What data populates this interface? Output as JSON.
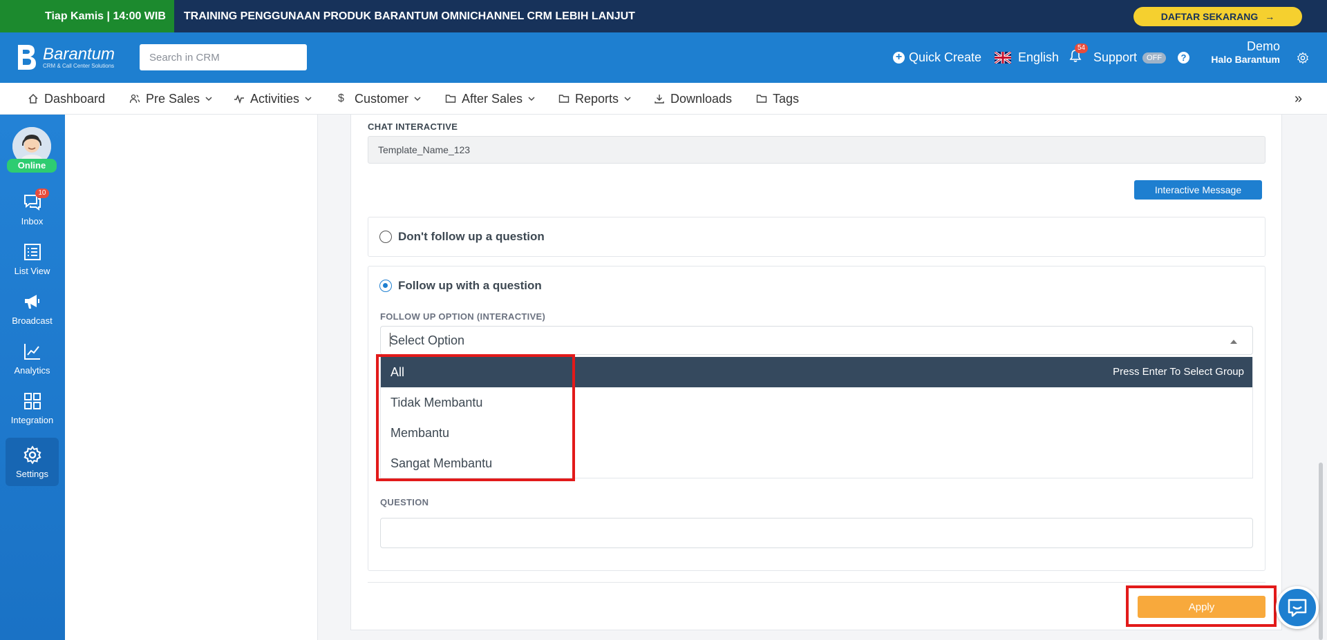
{
  "promo": {
    "schedule": "Tiap Kamis | 14:00 WIB",
    "title": "TRAINING PENGGUNAAN PRODUK BARANTUM OMNICHANNEL CRM LEBIH LANJUT",
    "cta": "DAFTAR SEKARANG",
    "colors": {
      "banner": "#17325a",
      "schedule_bg": "#1c8a2e",
      "cta_bg": "#f5d02f"
    }
  },
  "header": {
    "logo_name": "Barantum",
    "logo_tagline": "CRM & Call Center Solutions",
    "search_placeholder": "Search in CRM",
    "quick_create": "Quick Create",
    "language": "English",
    "notification_count": "54",
    "support_label": "Support",
    "support_toggle": "OFF",
    "help": "?",
    "user_name": "Demo",
    "user_company": "Halo Barantum",
    "accent": "#1e7fd0"
  },
  "menu": {
    "items": [
      {
        "label": "Dashboard",
        "icon": "home-icon",
        "dropdown": false
      },
      {
        "label": "Pre Sales",
        "icon": "users-icon",
        "dropdown": true
      },
      {
        "label": "Activities",
        "icon": "activity-icon",
        "dropdown": true
      },
      {
        "label": "Customer",
        "icon": "dollar-icon",
        "dropdown": true
      },
      {
        "label": "After Sales",
        "icon": "folder-icon",
        "dropdown": true
      },
      {
        "label": "Reports",
        "icon": "folder-icon",
        "dropdown": true
      },
      {
        "label": "Downloads",
        "icon": "download-icon",
        "dropdown": false
      },
      {
        "label": "Tags",
        "icon": "folder-icon",
        "dropdown": false
      }
    ],
    "more": "»"
  },
  "sidebar": {
    "status": "Online",
    "items": [
      {
        "label": "Inbox",
        "icon": "chat-icon",
        "badge": "10"
      },
      {
        "label": "List View",
        "icon": "list-icon"
      },
      {
        "label": "Broadcast",
        "icon": "megaphone-icon"
      },
      {
        "label": "Analytics",
        "icon": "chart-line-icon"
      },
      {
        "label": "Integration",
        "icon": "grid-icon"
      },
      {
        "label": "Settings",
        "icon": "gear-icon",
        "active": true
      }
    ]
  },
  "form": {
    "chat_interactive_label": "CHAT INTERACTIVE",
    "chat_interactive_value": "Template_Name_123",
    "interactive_message_button": "Interactive Message",
    "option_no_follow": "Don't follow up a question",
    "option_follow": "Follow up with a question",
    "selected_option": "follow",
    "follow_up_label": "FOLLOW UP OPTION (INTERACTIVE)",
    "select_placeholder": "Select Option",
    "dropdown_options": [
      "All",
      "Tidak Membantu",
      "Membantu",
      "Sangat Membantu"
    ],
    "dropdown_hint": "Press Enter To Select Group",
    "question_label": "QUESTION",
    "question_value": "",
    "apply_button": "Apply",
    "apply_color": "#f8a93c",
    "highlight_color": "#35495e"
  }
}
